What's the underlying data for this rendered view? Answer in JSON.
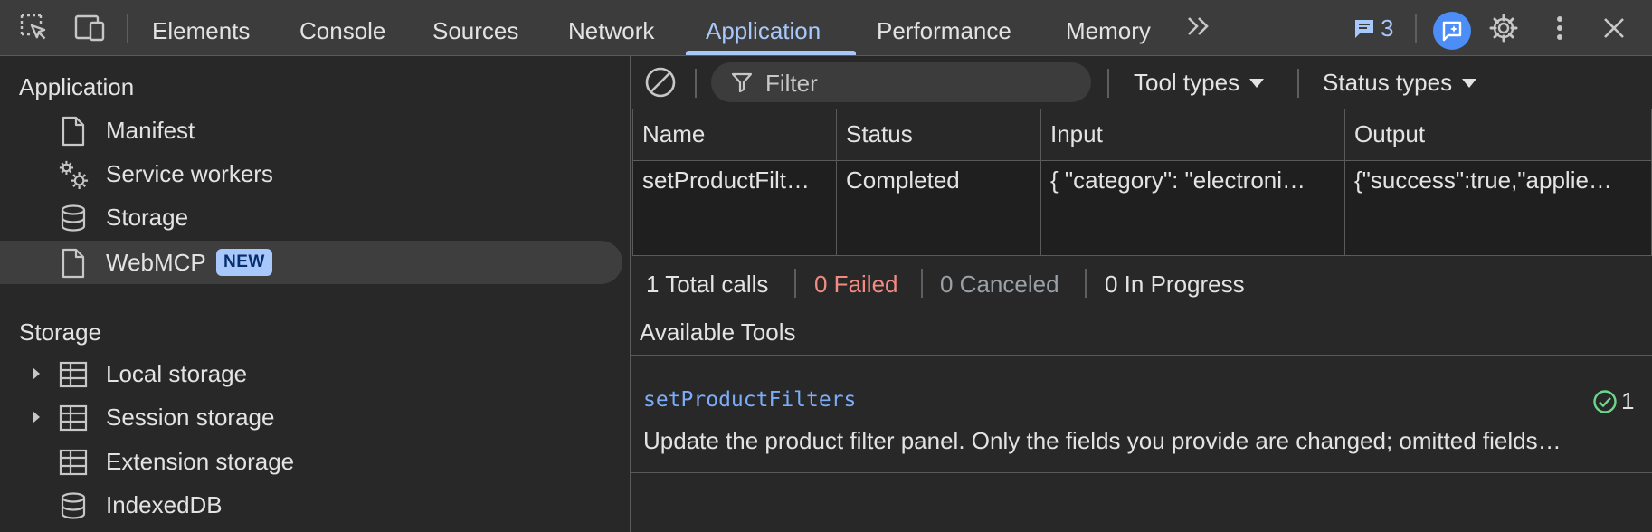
{
  "toolbar": {
    "tabs": [
      {
        "label": "Elements"
      },
      {
        "label": "Console"
      },
      {
        "label": "Sources"
      },
      {
        "label": "Network"
      },
      {
        "label": "Application"
      },
      {
        "label": "Performance"
      },
      {
        "label": "Memory"
      }
    ],
    "active_tab": "Application",
    "issues_count": "3",
    "accent_color": "#a8c7fa"
  },
  "sidebar": {
    "application_title": "Application",
    "app_items": [
      {
        "label": "Manifest",
        "icon": "document-icon"
      },
      {
        "label": "Service workers",
        "icon": "gears-icon"
      },
      {
        "label": "Storage",
        "icon": "database-icon"
      },
      {
        "label": "WebMCP",
        "icon": "document-icon",
        "badge": "NEW",
        "selected": true
      }
    ],
    "storage_title": "Storage",
    "storage_items": [
      {
        "label": "Local storage",
        "icon": "table-icon",
        "expandable": true
      },
      {
        "label": "Session storage",
        "icon": "table-icon",
        "expandable": true
      },
      {
        "label": "Extension storage",
        "icon": "table-icon",
        "expandable": false
      },
      {
        "label": "IndexedDB",
        "icon": "database-icon",
        "expandable": false
      }
    ]
  },
  "main": {
    "filter_placeholder": "Filter",
    "tool_types_label": "Tool types",
    "status_types_label": "Status types",
    "table": {
      "columns": [
        "Name",
        "Status",
        "Input",
        "Output"
      ],
      "rows": [
        [
          "setProductFilt…",
          "Completed",
          "{ \"category\": \"electroni…",
          "{\"success\":true,\"applie…"
        ]
      ]
    },
    "stats": {
      "total": "1 Total calls",
      "failed": "0 Failed",
      "canceled": "0 Canceled",
      "in_progress": "0 In Progress",
      "failed_color": "#f28b82",
      "canceled_color": "#9aa0a6"
    },
    "available_tools_title": "Available Tools",
    "tools": [
      {
        "name": "setProductFilters",
        "count": "1",
        "description": "Update the product filter panel. Only the fields you provide are changed; omitted fields…"
      }
    ]
  }
}
